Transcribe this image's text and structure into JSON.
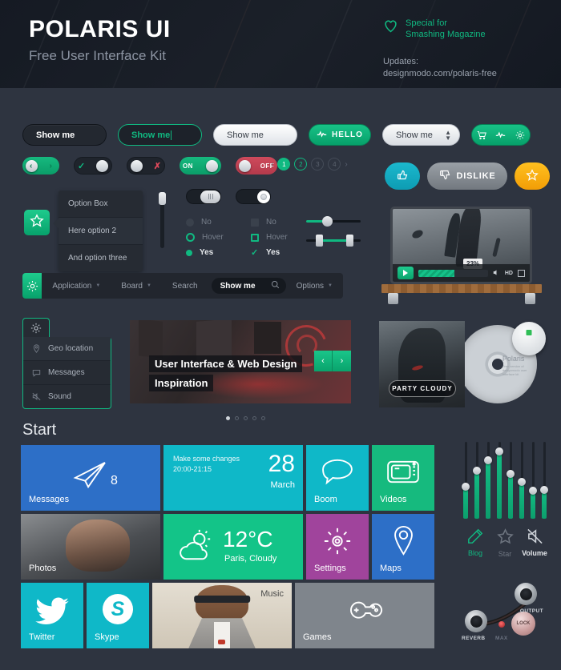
{
  "header": {
    "title": "POLARIS UI",
    "subtitle": "Free User Interface Kit",
    "special_line1": "Special for",
    "special_line2": "Smashing Magazine",
    "updates_label": "Updates:",
    "updates_url": "designmodo.com/polaris-free",
    "heart_icon": "heart-icon",
    "accent": "#10b981"
  },
  "buttons": {
    "dark_label": "Show me",
    "outline_label": "Show me",
    "white_label": "Show me",
    "green_label": "HELLO",
    "select_value": "Show me",
    "icon_group": [
      "cart-icon",
      "pulse-icon",
      "gear-icon"
    ]
  },
  "toggles": {
    "on_label": "ON",
    "off_label": "OFF",
    "check_icon": "check-icon",
    "x_icon": "x-icon",
    "prev_icon": "chevron-left-icon",
    "next_icon": "chevron-right-icon"
  },
  "pagination": {
    "prev": "‹",
    "next": "›",
    "pages": [
      "1",
      "2",
      "3",
      "4"
    ],
    "active": "1",
    "hover": "2"
  },
  "social": {
    "like_label": "",
    "dislike_label": "DISLIKE",
    "star_label": "",
    "like_icon": "thumbs-up-icon",
    "dislike_icon": "thumbs-down-icon",
    "star_icon": "star-icon"
  },
  "option_box": {
    "star_icon": "star-icon",
    "items": [
      "Option Box",
      "Here option 2",
      "And option three"
    ]
  },
  "choices": {
    "radio": [
      {
        "label": "No",
        "state": "off"
      },
      {
        "label": "Hover",
        "state": "hover"
      },
      {
        "label": "Yes",
        "state": "on"
      }
    ],
    "checkbox": [
      {
        "label": "No",
        "state": "off"
      },
      {
        "label": "Hover",
        "state": "hover"
      },
      {
        "label": "Yes",
        "state": "on"
      }
    ]
  },
  "navbar": {
    "gear_icon": "gear-icon",
    "items": [
      "Application",
      "Board",
      "Search",
      "Options"
    ],
    "search_value": "Show me",
    "search_icon": "search-icon"
  },
  "video": {
    "progress_badge": "23%",
    "hd_label": "HD",
    "play_icon": "play-icon",
    "volume_icon": "volume-icon",
    "fullscreen_icon": "fullscreen-icon"
  },
  "geo_menu": {
    "gear_icon": "gear-icon",
    "items": [
      {
        "label": "Geo location",
        "icon": "pin-icon"
      },
      {
        "label": "Messages",
        "icon": "speech-bubble-icon"
      },
      {
        "label": "Sound",
        "icon": "mute-icon"
      }
    ]
  },
  "banner": {
    "title_line1": "User Interface & Web Design",
    "title_line2": "Inspiration",
    "prev_icon": "chevron-left-icon",
    "next_icon": "chevron-right-icon",
    "dot_count": 5,
    "active_dot": 0
  },
  "cd": {
    "badge": "PARTY CLOUDY",
    "disc_title": "Polaris",
    "disc_sub": "Free version of designmodo user interface kit"
  },
  "start": {
    "heading": "Start",
    "tiles": [
      {
        "name": "messages",
        "label": "Messages",
        "badge": "8",
        "icon": "paper-plane-icon",
        "color": "#2d6fc7"
      },
      {
        "name": "calendar",
        "label": "",
        "line1": "Make some changes",
        "line2": "20:00-21:15",
        "day": "28",
        "month": "March",
        "color": "#0fb8c8"
      },
      {
        "name": "boom",
        "label": "Boom",
        "icon": "speech-bubble-icon",
        "color": "#0fb8c8"
      },
      {
        "name": "videos",
        "label": "Videos",
        "icon": "tv-icon",
        "color": "#16ba7e"
      },
      {
        "name": "photos",
        "label": "Photos",
        "icon": "",
        "color": "#4b4e52"
      },
      {
        "name": "weather",
        "label": "",
        "temp": "12°C",
        "sub": "Paris, Cloudy",
        "icon": "sun-cloud-icon",
        "color": "#13c488"
      },
      {
        "name": "settings",
        "label": "Settings",
        "icon": "gear-icon",
        "color": "#a0449c"
      },
      {
        "name": "maps",
        "label": "Maps",
        "icon": "pin-icon",
        "color": "#2d6fc7"
      },
      {
        "name": "twitter",
        "label": "Twitter",
        "icon": "twitter-icon",
        "color": "#0fb8c8"
      },
      {
        "name": "skype",
        "label": "Skype",
        "icon": "skype-icon",
        "color": "#0fb8c8"
      },
      {
        "name": "music",
        "label": "Music",
        "icon": "",
        "color": "#ded7ca"
      },
      {
        "name": "games",
        "label": "Games",
        "icon": "gamepad-icon",
        "color": "#7f858c"
      }
    ]
  },
  "equalizer": {
    "channels": [
      {
        "value": 42
      },
      {
        "value": 62
      },
      {
        "value": 76
      },
      {
        "value": 88
      },
      {
        "value": 58
      },
      {
        "value": 48
      },
      {
        "value": 36
      },
      {
        "value": 38
      }
    ]
  },
  "icon_row": [
    {
      "label": "Blog",
      "icon": "pencil-icon"
    },
    {
      "label": "Star",
      "icon": "star-icon"
    },
    {
      "label": "Volume",
      "icon": "mute-icon"
    }
  ],
  "jacks": {
    "reverb_label": "REVERB",
    "output_label": "OUTPUT",
    "max_label": "MAX",
    "lock_label": "LOCK"
  }
}
